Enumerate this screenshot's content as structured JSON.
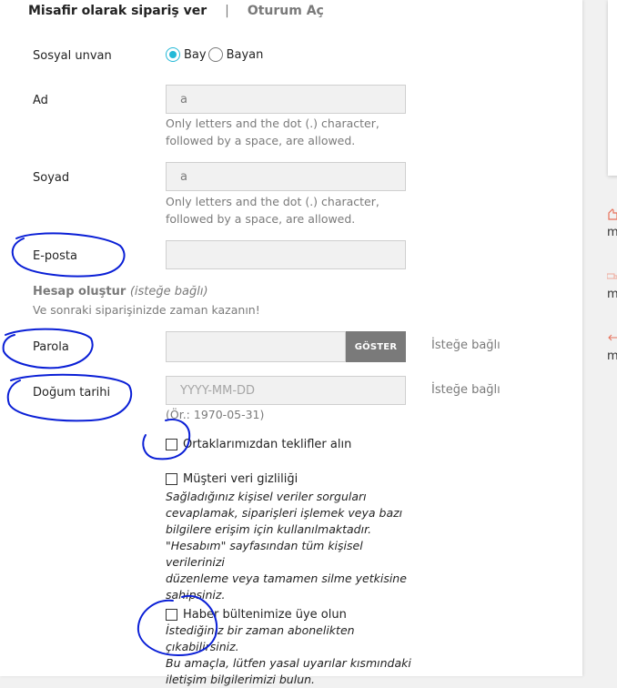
{
  "tabs": {
    "guest": "Misafir olarak sipariş ver",
    "separator": "|",
    "login": "Oturum Aç"
  },
  "form": {
    "social_title": {
      "label": "Sosyal unvan",
      "options": [
        "Bay",
        "Bayan"
      ],
      "selected": "Bay"
    },
    "first_name": {
      "label": "Ad",
      "value": "a",
      "hint_line1": "Only letters and the dot (.) character,",
      "hint_line2": "followed by a space, are allowed."
    },
    "last_name": {
      "label": "Soyad",
      "value": "a",
      "hint_line1": "Only letters and the dot (.) character,",
      "hint_line2": "followed by a space, are allowed."
    },
    "email": {
      "label": "E-posta",
      "value": ""
    },
    "account": {
      "title": "Hesap oluştur",
      "title_optional": "(isteğe bağlı)",
      "subtitle": "Ve sonraki siparişinizde zaman kazanın!"
    },
    "password": {
      "label": "Parola",
      "value": "",
      "show_button": "GÖSTER",
      "optional": "İsteğe bağlı"
    },
    "birthdate": {
      "label": "Doğum tarihi",
      "placeholder": "YYYY-MM-DD",
      "example": "(Ör.: 1970-05-31)",
      "optional": "İsteğe bağlı"
    },
    "partner_offers": {
      "label": "Ortaklarımızdan teklifler alın"
    },
    "privacy": {
      "label": "Müşteri veri gizliliği",
      "desc": [
        "Sağladığınız kişisel veriler sorguları",
        "cevaplamak, siparişleri işlemek veya bazı",
        "bilgilere erişim için kullanılmaktadır.",
        "\"Hesabım\" sayfasından tüm kişisel verilerinizi",
        "düzenleme veya tamamen silme yetkisine",
        "sahipsiniz."
      ]
    },
    "newsletter": {
      "label": "Haber bültenimize üye olun",
      "desc": [
        "İstediğiniz bir zaman abonelikten çıkabilirsiniz.",
        "Bu amaçla, lütfen yasal uyarılar kısmındaki",
        "iletişim bilgilerimizi bulun."
      ]
    }
  },
  "sidebar": {
    "letters": [
      "m",
      "m",
      "m"
    ]
  },
  "colors": {
    "accent": "#24b9d7",
    "annotation": "#0a1fd6",
    "button": "#7a7a7a"
  }
}
